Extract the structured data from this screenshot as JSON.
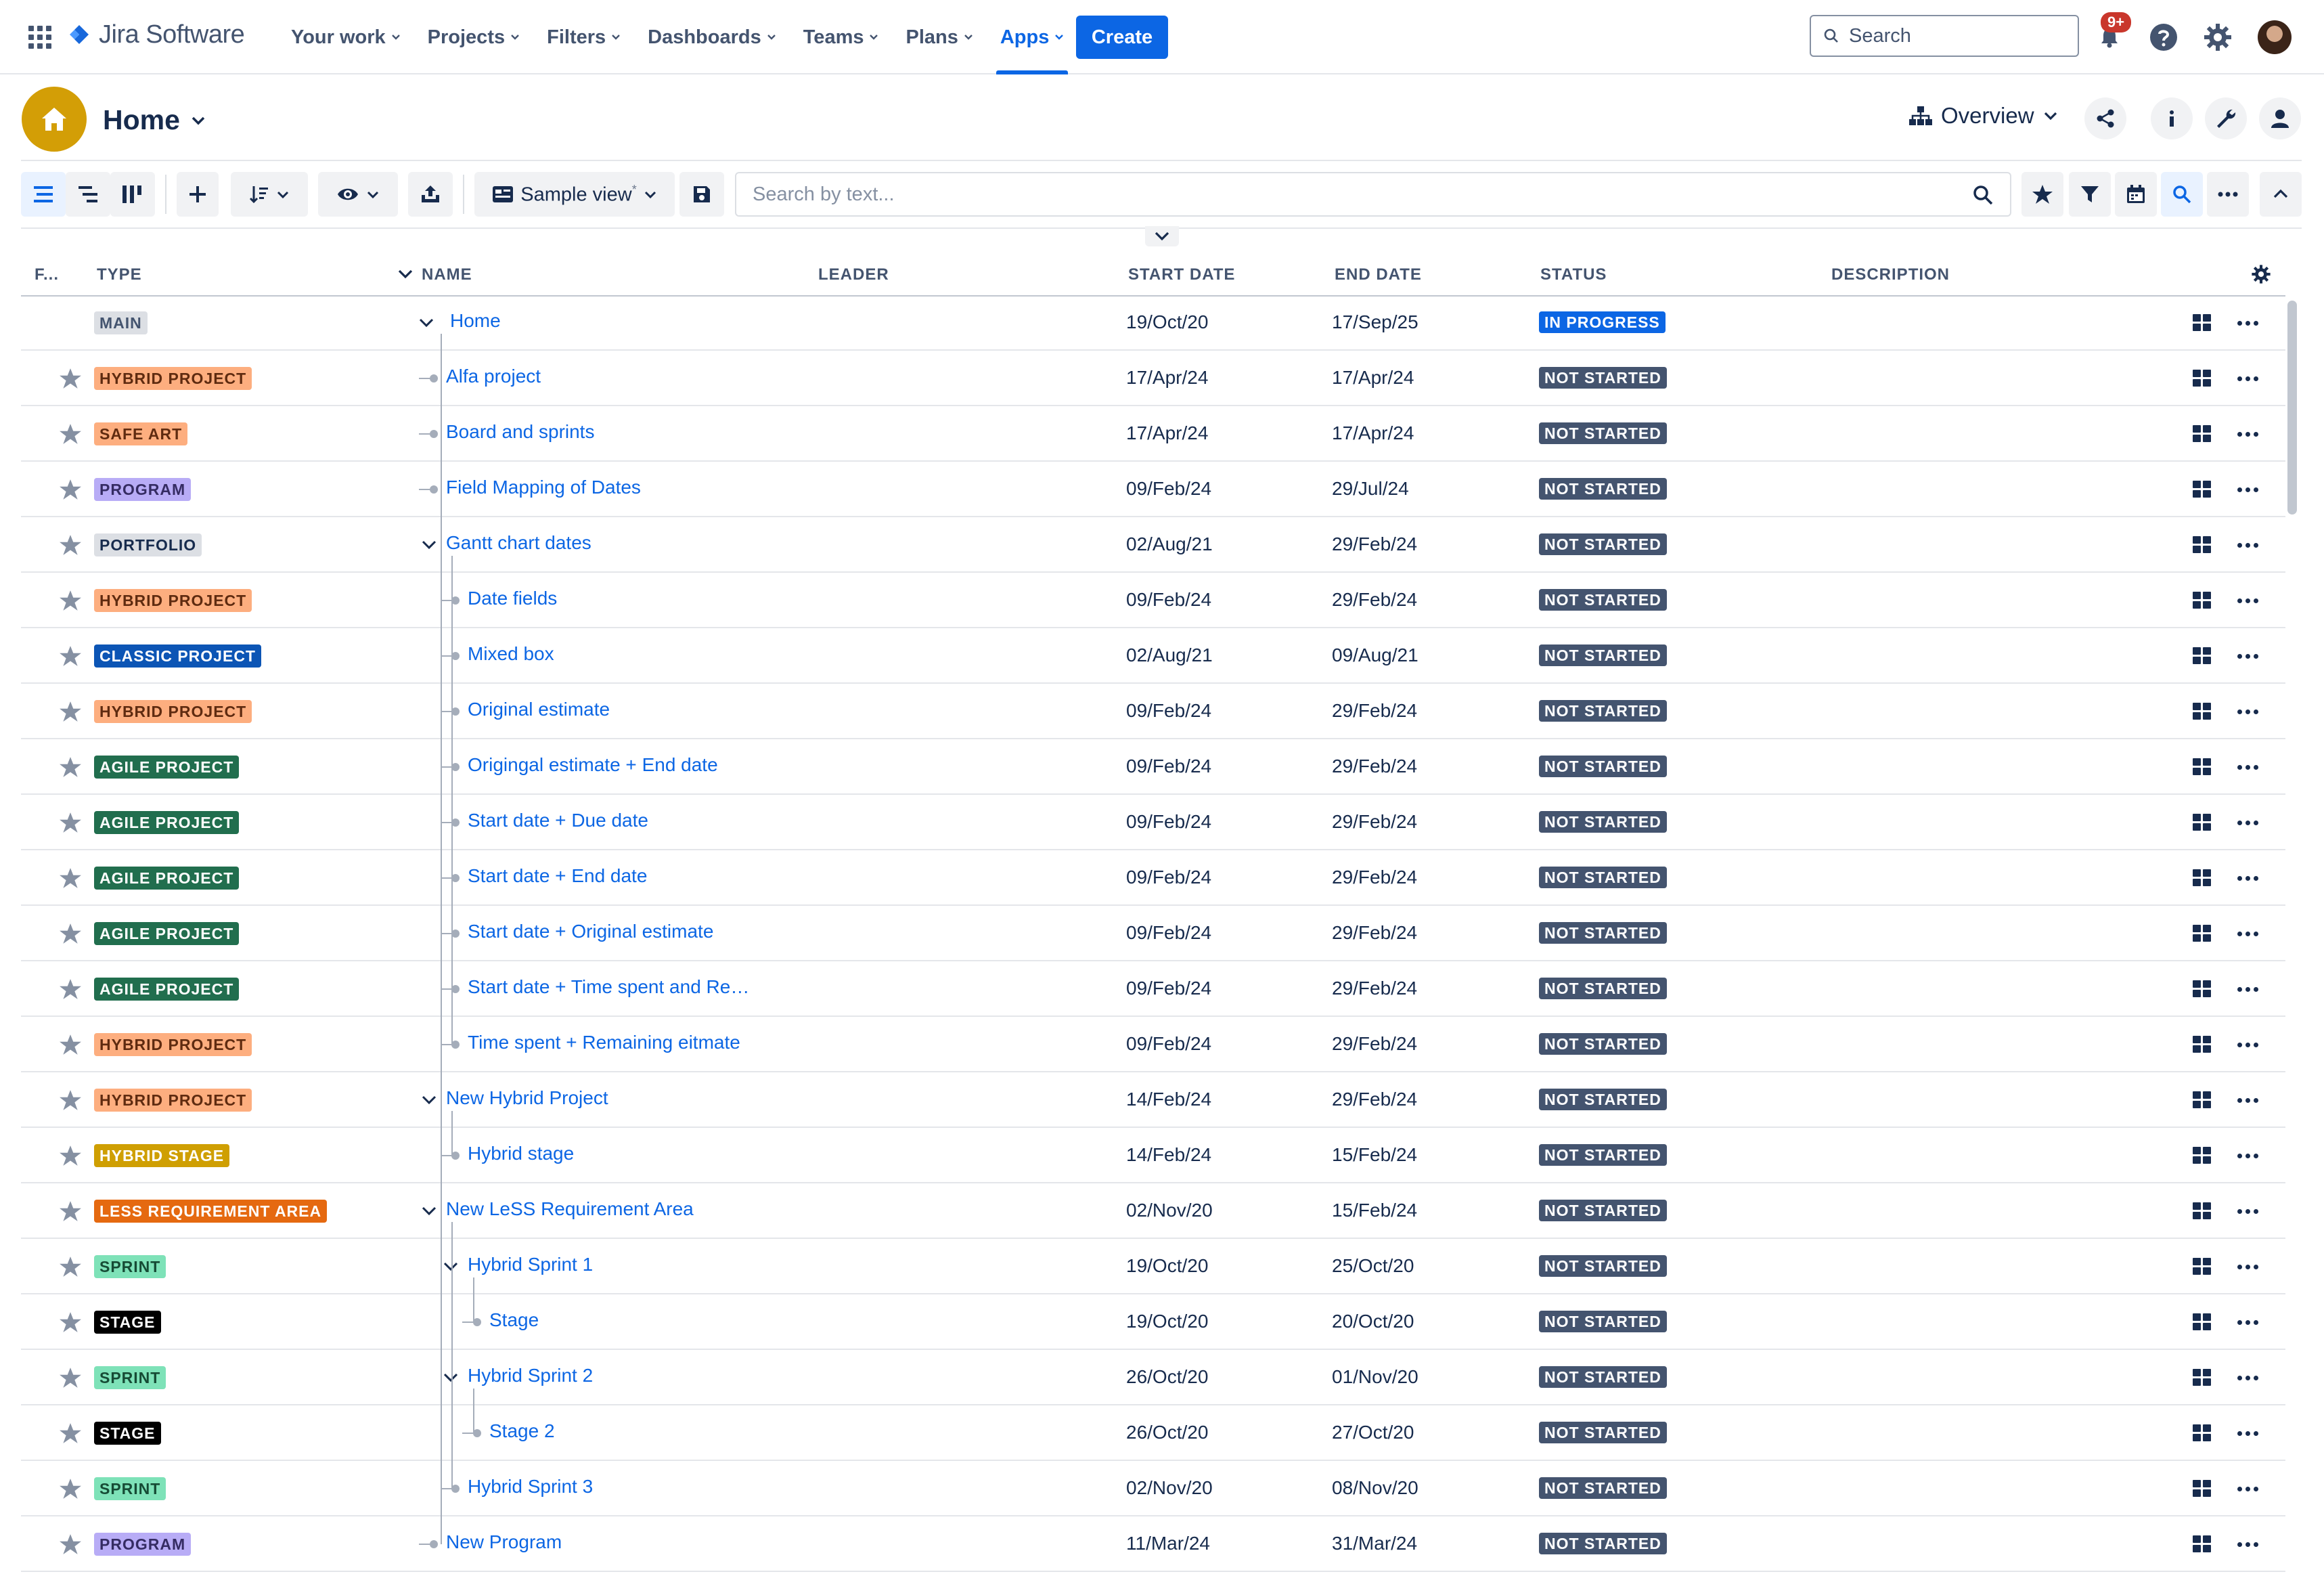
{
  "topnav": {
    "logo_text": "Jira Software",
    "items": [
      {
        "label": "Your work",
        "active": false
      },
      {
        "label": "Projects",
        "active": false
      },
      {
        "label": "Filters",
        "active": false
      },
      {
        "label": "Dashboards",
        "active": false
      },
      {
        "label": "Teams",
        "active": false
      },
      {
        "label": "Plans",
        "active": false
      },
      {
        "label": "Apps",
        "active": true
      }
    ],
    "create_label": "Create",
    "search_placeholder": "Search",
    "notification_count": "9+",
    "icons": [
      "app-switcher-icon",
      "jira-logo-icon",
      "bell-icon",
      "help-icon",
      "settings-icon"
    ]
  },
  "page": {
    "title": "Home",
    "view_label": "Overview",
    "header_icons": [
      "share-icon",
      "info-icon",
      "wrench-icon",
      "user-icon"
    ]
  },
  "toolbar": {
    "view_name": "Sample view",
    "view_modified_mark": "*",
    "search_placeholder": "Search by text...",
    "icons": [
      "list-view-icon",
      "tree-view-icon",
      "board-view-icon",
      "add-icon",
      "sort-icon",
      "eye-icon",
      "export-icon",
      "save-icon",
      "star-icon",
      "filter-icon",
      "calendar-icon",
      "search-icon",
      "more-icon",
      "collapse-icon"
    ]
  },
  "table": {
    "columns": {
      "fav": "F...",
      "type": "TYPE",
      "name": "NAME",
      "leader": "LEADER",
      "start": "START DATE",
      "end": "END DATE",
      "status": "STATUS",
      "description": "DESCRIPTION"
    },
    "rows": [
      {
        "type": "MAIN",
        "name": "Home",
        "start": "19/Oct/20",
        "end": "17/Sep/25",
        "status": "IN PROGRESS",
        "depth": 0,
        "expanded": true
      },
      {
        "type": "HYBRID PROJECT",
        "name": "Alfa project",
        "start": "17/Apr/24",
        "end": "17/Apr/24",
        "status": "NOT STARTED",
        "depth": 1,
        "expanded": false
      },
      {
        "type": "SAFE ART",
        "name": "Board and sprints",
        "start": "17/Apr/24",
        "end": "17/Apr/24",
        "status": "NOT STARTED",
        "depth": 1,
        "expanded": false
      },
      {
        "type": "PROGRAM",
        "name": "Field Mapping of Dates",
        "start": "09/Feb/24",
        "end": "29/Jul/24",
        "status": "NOT STARTED",
        "depth": 1,
        "expanded": false
      },
      {
        "type": "PORTFOLIO",
        "name": "Gantt chart dates",
        "start": "02/Aug/21",
        "end": "29/Feb/24",
        "status": "NOT STARTED",
        "depth": 1,
        "expanded": true
      },
      {
        "type": "HYBRID PROJECT",
        "name": "Date fields",
        "start": "09/Feb/24",
        "end": "29/Feb/24",
        "status": "NOT STARTED",
        "depth": 2,
        "expanded": false
      },
      {
        "type": "CLASSIC PROJECT",
        "name": "Mixed box",
        "start": "02/Aug/21",
        "end": "09/Aug/21",
        "status": "NOT STARTED",
        "depth": 2,
        "expanded": false
      },
      {
        "type": "HYBRID PROJECT",
        "name": "Original estimate",
        "start": "09/Feb/24",
        "end": "29/Feb/24",
        "status": "NOT STARTED",
        "depth": 2,
        "expanded": false
      },
      {
        "type": "AGILE PROJECT",
        "name": "Origingal estimate + End date",
        "start": "09/Feb/24",
        "end": "29/Feb/24",
        "status": "NOT STARTED",
        "depth": 2,
        "expanded": false
      },
      {
        "type": "AGILE PROJECT",
        "name": "Start date + Due date",
        "start": "09/Feb/24",
        "end": "29/Feb/24",
        "status": "NOT STARTED",
        "depth": 2,
        "expanded": false
      },
      {
        "type": "AGILE PROJECT",
        "name": "Start date + End date",
        "start": "09/Feb/24",
        "end": "29/Feb/24",
        "status": "NOT STARTED",
        "depth": 2,
        "expanded": false
      },
      {
        "type": "AGILE PROJECT",
        "name": "Start date + Original estimate",
        "start": "09/Feb/24",
        "end": "29/Feb/24",
        "status": "NOT STARTED",
        "depth": 2,
        "expanded": false
      },
      {
        "type": "AGILE PROJECT",
        "name": "Start date + Time spent and Re…",
        "start": "09/Feb/24",
        "end": "29/Feb/24",
        "status": "NOT STARTED",
        "depth": 2,
        "expanded": false
      },
      {
        "type": "HYBRID PROJECT",
        "name": "Time spent + Remaining eitmate",
        "start": "09/Feb/24",
        "end": "29/Feb/24",
        "status": "NOT STARTED",
        "depth": 2,
        "expanded": false
      },
      {
        "type": "HYBRID PROJECT",
        "name": "New Hybrid Project",
        "start": "14/Feb/24",
        "end": "29/Feb/24",
        "status": "NOT STARTED",
        "depth": 1,
        "expanded": true
      },
      {
        "type": "HYBRID STAGE",
        "name": "Hybrid stage",
        "start": "14/Feb/24",
        "end": "15/Feb/24",
        "status": "NOT STARTED",
        "depth": 2,
        "expanded": false
      },
      {
        "type": "LESS REQUIREMENT AREA",
        "name": "New LeSS Requirement Area",
        "start": "02/Nov/20",
        "end": "15/Feb/24",
        "status": "NOT STARTED",
        "depth": 1,
        "expanded": true
      },
      {
        "type": "SPRINT",
        "name": "Hybrid Sprint 1",
        "start": "19/Oct/20",
        "end": "25/Oct/20",
        "status": "NOT STARTED",
        "depth": 2,
        "expanded": true
      },
      {
        "type": "STAGE",
        "name": "Stage",
        "start": "19/Oct/20",
        "end": "20/Oct/20",
        "status": "NOT STARTED",
        "depth": 3,
        "expanded": false
      },
      {
        "type": "SPRINT",
        "name": "Hybrid Sprint 2",
        "start": "26/Oct/20",
        "end": "01/Nov/20",
        "status": "NOT STARTED",
        "depth": 2,
        "expanded": true
      },
      {
        "type": "STAGE",
        "name": "Stage 2",
        "start": "26/Oct/20",
        "end": "27/Oct/20",
        "status": "NOT STARTED",
        "depth": 3,
        "expanded": false
      },
      {
        "type": "SPRINT",
        "name": "Hybrid Sprint 3",
        "start": "02/Nov/20",
        "end": "08/Nov/20",
        "status": "NOT STARTED",
        "depth": 2,
        "expanded": false
      },
      {
        "type": "PROGRAM",
        "name": "New Program",
        "start": "11/Mar/24",
        "end": "31/Mar/24",
        "status": "NOT STARTED",
        "depth": 1,
        "expanded": false
      }
    ]
  },
  "type_colors": {
    "MAIN": {
      "bg": "#dcdfe4",
      "fg": "#44546f"
    },
    "HYBRID PROJECT": {
      "bg": "#fdae7f",
      "fg": "#5f2b10"
    },
    "SAFE ART": {
      "bg": "#fdae7f",
      "fg": "#5f2b10"
    },
    "PROGRAM": {
      "bg": "#b8acf6",
      "fg": "#352c63"
    },
    "PORTFOLIO": {
      "bg": "#dcdfe4",
      "fg": "#172b4d"
    },
    "CLASSIC PROJECT": {
      "bg": "#0c55b5",
      "fg": "#ffffff"
    },
    "AGILE PROJECT": {
      "bg": "#216e4e",
      "fg": "#ffffff"
    },
    "HYBRID STAGE": {
      "bg": "#cf9f02",
      "fg": "#ffffff"
    },
    "LESS REQUIREMENT AREA": {
      "bg": "#e56910",
      "fg": "#ffffff"
    },
    "SPRINT": {
      "bg": "#7ee2b8",
      "fg": "#164b35"
    },
    "STAGE": {
      "bg": "#000000",
      "fg": "#ffffff"
    }
  },
  "status_colors": {
    "IN PROGRESS": "#0c66e4",
    "NOT STARTED": "#44546f"
  }
}
